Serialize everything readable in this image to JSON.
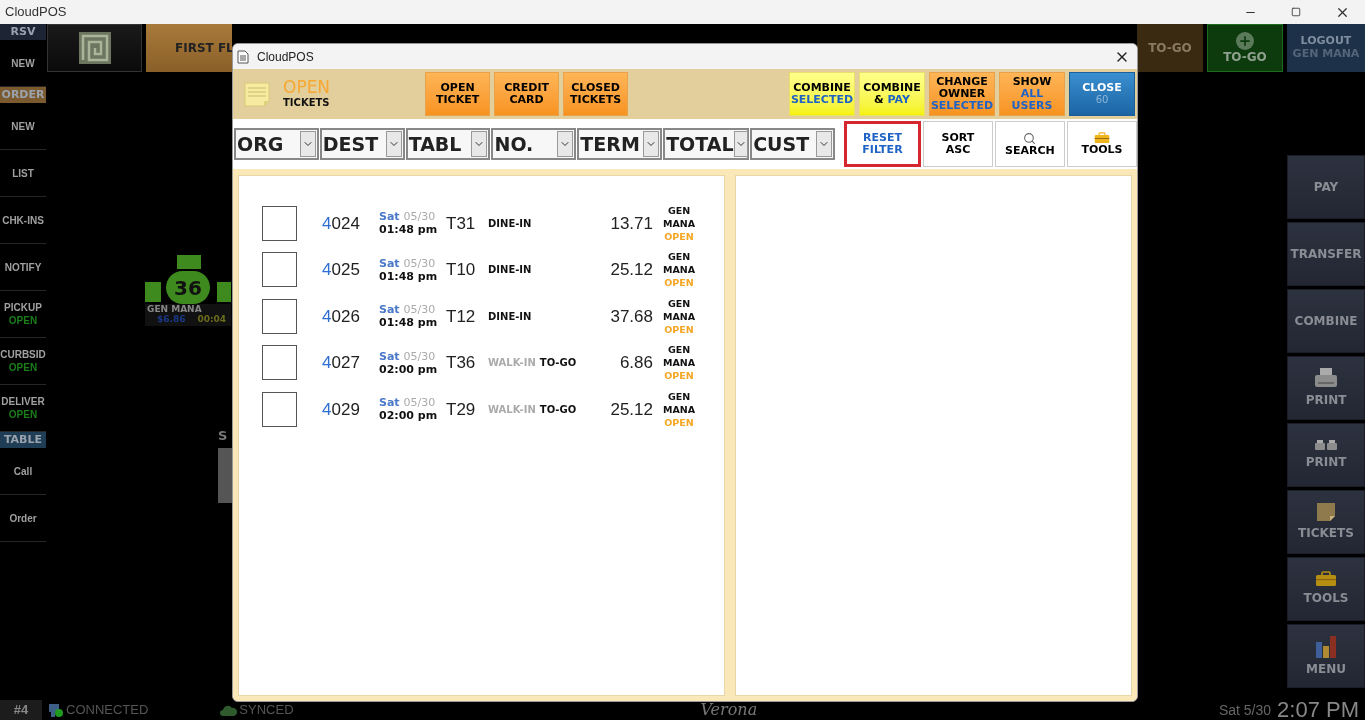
{
  "app_title": "CloudPOS",
  "sidebar": [
    {
      "kind": "header",
      "label": "RSV",
      "color": "#1d2535"
    },
    {
      "kind": "item",
      "label": "NEW"
    },
    {
      "kind": "header",
      "label": "ORDER",
      "color": "#7a5a2e"
    },
    {
      "kind": "item",
      "label": "NEW"
    },
    {
      "kind": "item",
      "label": "LIST"
    },
    {
      "kind": "item",
      "label": "CHK-INS"
    },
    {
      "kind": "item",
      "label": "NOTIFY"
    },
    {
      "kind": "item",
      "label": "PICKUP",
      "status": "OPEN"
    },
    {
      "kind": "item",
      "label": "CURBSID",
      "status": "OPEN"
    },
    {
      "kind": "item",
      "label": "DELIVER",
      "status": "OPEN"
    },
    {
      "kind": "header",
      "label": "TABLE",
      "color": "#1f3d55"
    },
    {
      "kind": "item",
      "label": "Call"
    },
    {
      "kind": "item",
      "label": "Order"
    }
  ],
  "top_bar": {
    "floor_tab": "FIRST FL",
    "buttons": [
      {
        "kind": "togo",
        "label": "TO-GO"
      },
      {
        "kind": "new-togo",
        "label": "TO-GO"
      },
      {
        "kind": "logout",
        "label": "LOGOUT",
        "sublabel": "GEN MANA"
      }
    ]
  },
  "table_widget": {
    "number": "36",
    "server": "GEN MANA",
    "amount": "$6.86",
    "elapsed": "00:04"
  },
  "canvas_label": "S",
  "actions": [
    {
      "kind": "text",
      "label": "PAY"
    },
    {
      "kind": "text",
      "label": "TRANSFER"
    },
    {
      "kind": "text",
      "label": "COMBINE"
    },
    {
      "kind": "printer",
      "label": "PRINT"
    },
    {
      "kind": "printers",
      "label": "PRINT"
    },
    {
      "kind": "note",
      "label": "TICKETS"
    },
    {
      "kind": "toolbox",
      "label": "TOOLS"
    },
    {
      "kind": "chart",
      "label": "MENU"
    }
  ],
  "status_bar": {
    "terminal": "#4",
    "connection": "CONNECTED",
    "sync": "SYNCED",
    "location": "Verona",
    "date": "Sat 5/30",
    "time": "2:07 PM"
  },
  "dialog": {
    "title": "CloudPOS",
    "heading": "OPEN",
    "subheading": "TICKETS",
    "buttons": [
      {
        "kind": "orange",
        "label": "OPEN TICKET"
      },
      {
        "kind": "orange",
        "label": "CREDIT CARD"
      },
      {
        "kind": "orange",
        "label": "CLOSED TICKETS"
      }
    ],
    "right_buttons": [
      {
        "kind": "yellow",
        "label": "COMBINE",
        "accent": "SELECTED"
      },
      {
        "kind": "yellow",
        "label": "COMBINE &",
        "accent": "PAY"
      },
      {
        "kind": "orange",
        "label": "CHANGE OWNER",
        "accent": "SELECTED"
      },
      {
        "kind": "orange",
        "label": "SHOW",
        "accent": "ALL USERS"
      },
      {
        "kind": "blue",
        "label": "CLOSE",
        "accent": "60"
      }
    ],
    "filters": [
      "ORG",
      "DEST",
      "TABL",
      "NO.",
      "TERM",
      "TOTAL",
      "CUST"
    ],
    "tools": [
      {
        "kind": "text",
        "label": "RESET FILTER",
        "highlighted": true
      },
      {
        "kind": "text",
        "label": "SORT ASC",
        "highlighted": false
      },
      {
        "kind": "search",
        "label": "SEARCH",
        "highlighted": false
      },
      {
        "kind": "toolbox",
        "label": "TOOLS",
        "highlighted": false
      }
    ],
    "tickets": [
      {
        "checked": false,
        "number_head": "4",
        "number_tail": "024",
        "day": "Sat",
        "date": "05/30",
        "time": "01:48 pm",
        "table": "T31",
        "destination": "DINE-IN",
        "total": "13.71",
        "owner": "GEN MANA",
        "status": "OPEN"
      },
      {
        "checked": false,
        "number_head": "4",
        "number_tail": "025",
        "day": "Sat",
        "date": "05/30",
        "time": "01:48 pm",
        "table": "T10",
        "destination": "DINE-IN",
        "total": "25.12",
        "owner": "GEN MANA",
        "status": "OPEN"
      },
      {
        "checked": false,
        "number_head": "4",
        "number_tail": "026",
        "day": "Sat",
        "date": "05/30",
        "time": "01:48 pm",
        "table": "T12",
        "destination": "DINE-IN",
        "total": "37.68",
        "owner": "GEN MANA",
        "status": "OPEN"
      },
      {
        "checked": false,
        "number_head": "4",
        "number_tail": "027",
        "day": "Sat",
        "date": "05/30",
        "time": "02:00 pm",
        "table": "T36",
        "origin": "WALK-IN",
        "destination": "TO-GO",
        "total": "6.86",
        "owner": "GEN MANA",
        "status": "OPEN"
      },
      {
        "checked": false,
        "number_head": "4",
        "number_tail": "029",
        "day": "Sat",
        "date": "05/30",
        "time": "02:00 pm",
        "table": "T29",
        "origin": "WALK-IN",
        "destination": "TO-GO",
        "total": "25.12",
        "owner": "GEN MANA",
        "status": "OPEN"
      }
    ]
  }
}
